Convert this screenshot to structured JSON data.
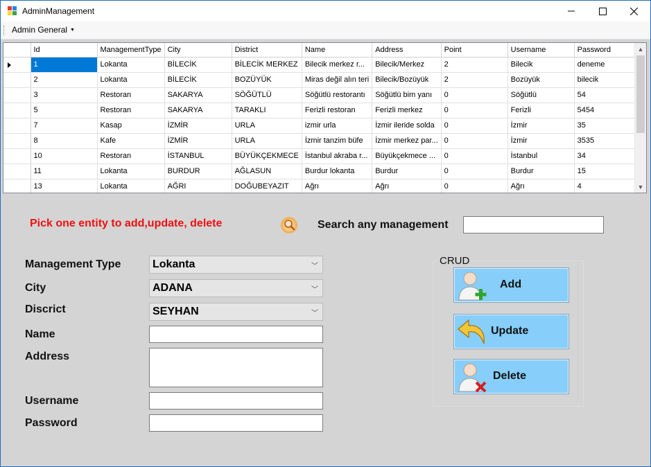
{
  "window": {
    "title": "AdminManagement"
  },
  "colors": {
    "accent_selection": "#0078d7",
    "info_text": "#ee1111",
    "crud_button_fill": "#87cefa",
    "form_background": "#d4d4d4"
  },
  "icons": {
    "app": "app-window-icon",
    "minimize": "minimize-icon",
    "maximize": "maximize-icon",
    "close": "close-icon",
    "search": "magnifier-search-icon",
    "add": "user-add-icon",
    "update": "undo-arrow-icon",
    "delete": "user-delete-icon"
  },
  "menu": {
    "admin_general": "Admin General"
  },
  "grid": {
    "columns": [
      "Id",
      "ManagementType",
      "City",
      "District",
      "Name",
      "Address",
      "Point",
      "Username",
      "Password"
    ],
    "rows": [
      [
        "1",
        "Lokanta",
        "BİLECİK",
        "BİLECİK MERKEZ",
        "Bilecik merkez r...",
        "Bilecik/Merkez",
        "2",
        "Bilecik",
        "deneme"
      ],
      [
        "2",
        "Lokanta",
        "BİLECİK",
        "BOZÜYÜK",
        "Miras değil alın teri",
        "Bilecik/Bozüyük",
        "2",
        "Bozüyük",
        "bilecik"
      ],
      [
        "3",
        "Restoran",
        "SAKARYA",
        "SÖĞÜTLÜ",
        "Söğütlü restorantı",
        "Söğütlü bim yanı",
        "0",
        "Söğütlü",
        "54"
      ],
      [
        "5",
        "Restoran",
        "SAKARYA",
        "TARAKLI",
        "Ferizli restoran",
        "Ferizli merkez",
        "0",
        "Ferizli",
        "5454"
      ],
      [
        "7",
        "Kasap",
        "İZMİR",
        "URLA",
        "izmir urla",
        "İzmir ileride solda",
        "0",
        "İzmir",
        "35"
      ],
      [
        "8",
        "Kafe",
        "İZMİR",
        "URLA",
        "İzmir tanzim büfe",
        "İzmir merkez par...",
        "0",
        "İzmir",
        "3535"
      ],
      [
        "10",
        "Restoran",
        "İSTANBUL",
        "BÜYÜKÇEKMECE",
        "İstanbul akraba r...",
        "Büyükçekmece  ...",
        "0",
        "İstanbul",
        "34"
      ],
      [
        "11",
        "Lokanta",
        "BURDUR",
        "AĞLASUN",
        "Burdur lokanta",
        "Burdur",
        "0",
        "Burdur",
        "15"
      ],
      [
        "13",
        "Lokanta",
        "AĞRI",
        "DOĞUBEYAZIT",
        "Ağrı",
        "Ağrı",
        "0",
        "Ağrı",
        "4"
      ]
    ]
  },
  "info": {
    "hint": "Pick one entity to add,update, delete"
  },
  "search": {
    "label": "Search any management",
    "value": ""
  },
  "form": {
    "management_type": {
      "label": "Management Type",
      "value": "Lokanta"
    },
    "city": {
      "label": "City",
      "value": "ADANA"
    },
    "district": {
      "label": "Discrict",
      "value": "SEYHAN"
    },
    "name": {
      "label": "Name",
      "value": ""
    },
    "address": {
      "label": "Address",
      "value": ""
    },
    "username": {
      "label": "Username",
      "value": ""
    },
    "password": {
      "label": "Password",
      "value": ""
    }
  },
  "crud": {
    "title": "CRUD",
    "add": "Add",
    "update": "Update",
    "delete": "Delete"
  }
}
